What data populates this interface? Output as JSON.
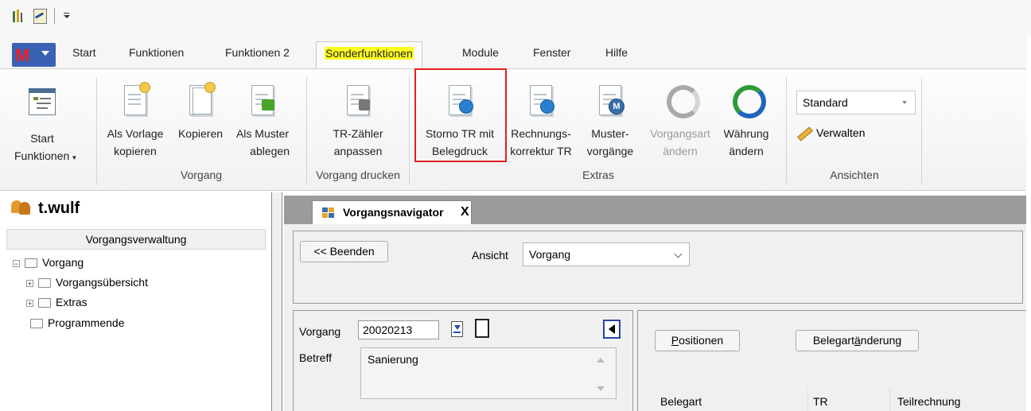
{
  "ribbon": {
    "tabs": [
      "Start",
      "Funktionen",
      "Funktionen 2",
      "Sonderfunktionen",
      "Module",
      "Fenster",
      "Hilfe"
    ],
    "active_tab": "Sonderfunktionen",
    "buttons": {
      "start_funktionen": {
        "line1": "Start",
        "line2": "Funktionen"
      },
      "als_vorlage": {
        "line1": "Als Vorlage",
        "line2": "kopieren"
      },
      "kopieren": {
        "line1": "Kopieren"
      },
      "als_muster": {
        "line1": "Als Muster",
        "line2": "ablegen"
      },
      "tr_zaehler": {
        "line1": "TR-Zähler",
        "line2": "anpassen"
      },
      "storno_tr": {
        "line1": "Storno TR mit",
        "line2": "Belegdruck"
      },
      "rechnungskorrektur": {
        "line1": "Rechnungs-",
        "line2": "korrektur TR"
      },
      "mustervorgaenge": {
        "line1": "Muster-",
        "line2": "vorgänge"
      },
      "vorgangsart": {
        "line1": "Vorgangsart",
        "line2": "ändern"
      },
      "waehrung": {
        "line1": "Währung",
        "line2": "ändern"
      }
    },
    "groups": {
      "vorgang": "Vorgang",
      "vorgang_drucken": "Vorgang drucken",
      "extras": "Extras",
      "ansichten": "Ansichten"
    },
    "ansichten_combo": "Standard",
    "verwalten": "Verwalten"
  },
  "left": {
    "user": "t.wulf",
    "panel_title": "Vorgangsverwaltung",
    "tree": {
      "root": "Vorgang",
      "child1": "Vorgangsübersicht",
      "child2": "Extras",
      "other": "Programmende"
    }
  },
  "document_tab": {
    "label": "Vorgangsnavigator",
    "close": "X"
  },
  "form": {
    "beenden": "<< Beenden",
    "ansicht_label": "Ansicht",
    "ansicht_value": "Vorgang",
    "vorgang_label": "Vorgang",
    "vorgang_value": "20020213",
    "betreff_label": "Betreff",
    "betreff_value": "Sanierung",
    "positionen_P": "P",
    "positionen_rest": "ositionen",
    "beleg_a": "Belegart",
    "beleg_u": "ä",
    "beleg_b": "nderung",
    "col_belegart": "Belegart",
    "col_tr": "TR",
    "col_teilrechnung": "Teilrechnung"
  },
  "colors": {
    "highlight": "#e02020",
    "active_tab_marker": "#ffff22",
    "app_button": "#3a62b4"
  }
}
